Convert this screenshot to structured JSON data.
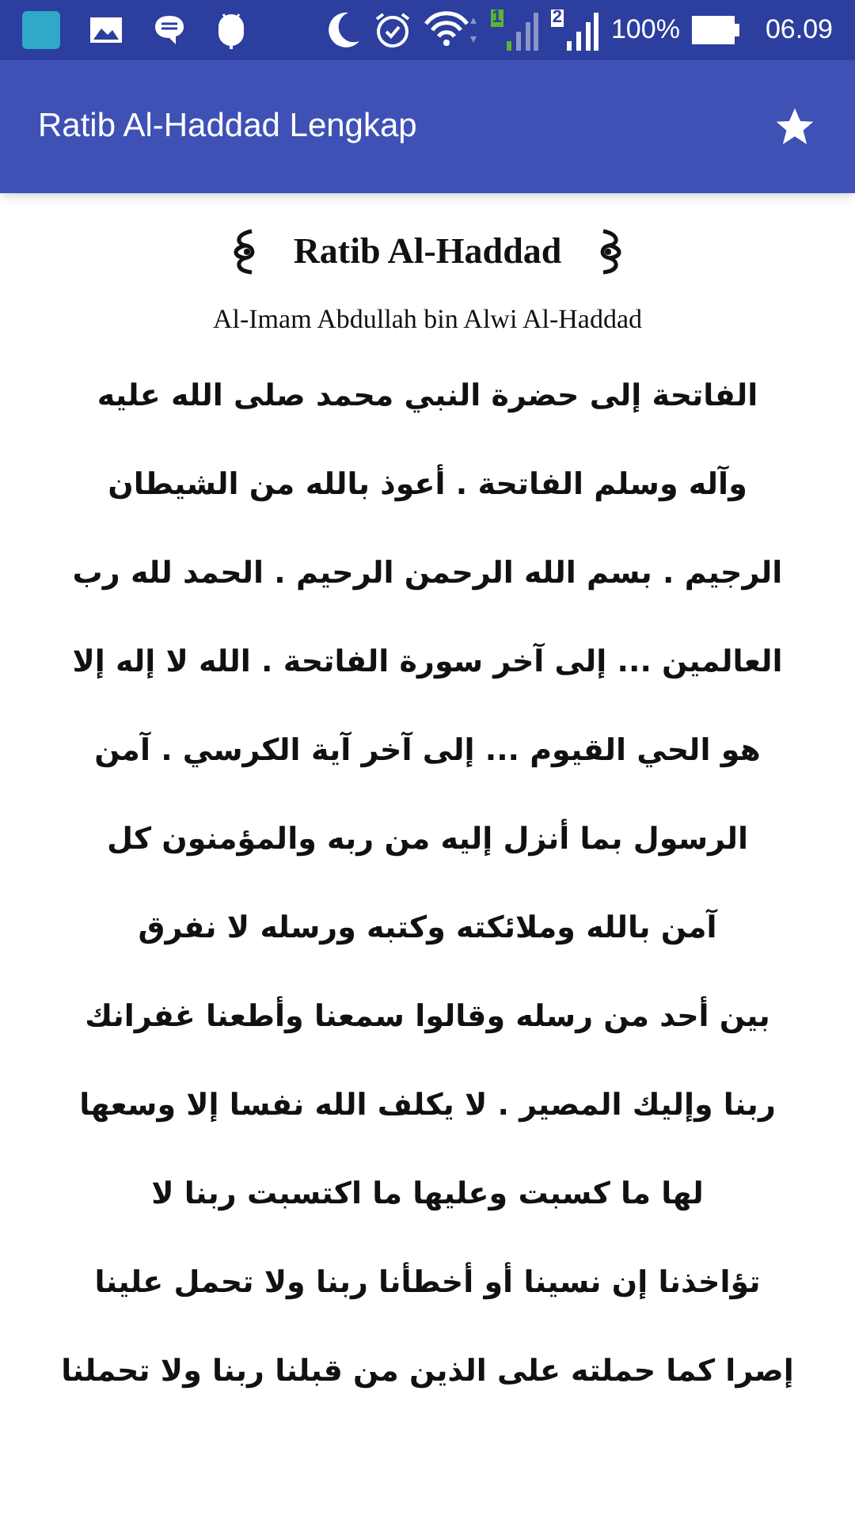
{
  "status_bar": {
    "sim_1_label": "1",
    "sim_2_label": "2",
    "battery": "100%",
    "time": "06.09"
  },
  "app_bar": {
    "title": "Ratib Al-Haddad Lengkap"
  },
  "document": {
    "title": "Ratib Al-Haddad",
    "subtitle": "Al-Imam Abdullah bin Alwi Al-Haddad",
    "lines": [
      "الفاتحة إلى حضرة النبي محمد صلى الله عليه",
      "وآله وسلم الفاتحة . أعوذ بالله من الشيطان",
      "الرجيم . بسم الله الرحمن الرحيم . الحمد لله رب",
      "العالمين ... إلى آخر سورة الفاتحة . الله لا إله إلا",
      "هو الحي القيوم ... إلى آخر آية الكرسي . آمن",
      "الرسول بما أنزل إليه من ربه والمؤمنون كل",
      "آمن بالله وملائكته وكتبه ورسله لا نفرق",
      "بين أحد من رسله وقالوا سمعنا وأطعنا غفرانك",
      "ربنا وإليك المصير . لا يكلف الله نفسا إلا وسعها",
      "لها ما كسبت وعليها ما اكتسبت ربنا لا",
      "تؤاخذنا إن نسينا أو أخطأنا ربنا ولا تحمل علينا",
      "إصرا كما حملته على الذين من قبلنا ربنا ولا تحملنا"
    ]
  }
}
